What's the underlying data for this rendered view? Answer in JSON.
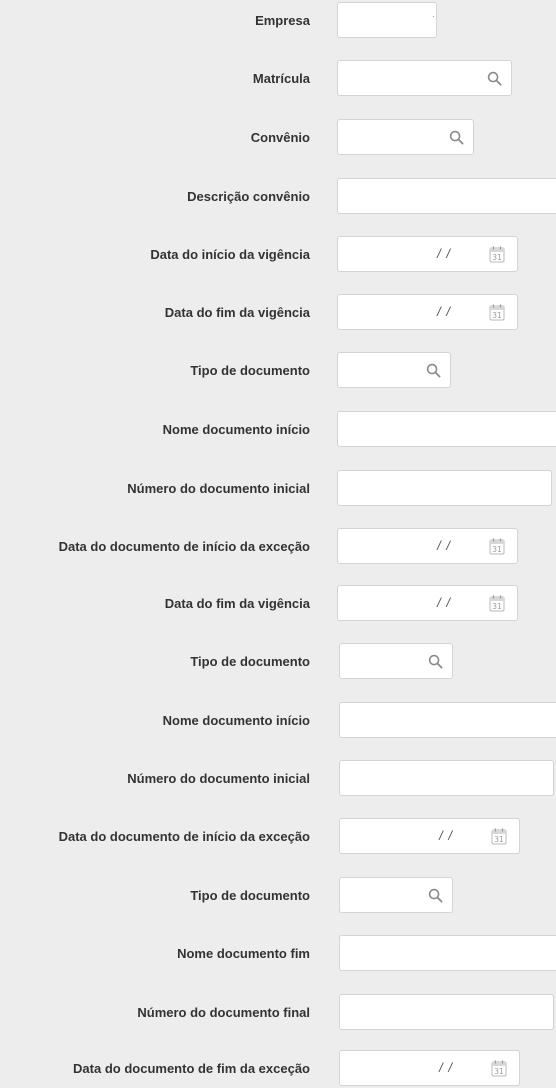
{
  "form": {
    "fields": [
      {
        "label": "Empresa",
        "type": "text"
      },
      {
        "label": "Matrícula",
        "type": "search"
      },
      {
        "label": "Convênio",
        "type": "search"
      },
      {
        "label": "Descrição convênio",
        "type": "text"
      },
      {
        "label": "Data do início da vigência",
        "type": "date",
        "value": "/ /"
      },
      {
        "label": "Data do fim da vigência",
        "type": "date",
        "value": "/ /"
      },
      {
        "label": "Tipo de documento",
        "type": "search"
      },
      {
        "label": "Nome documento início",
        "type": "text"
      },
      {
        "label": "Número do documento inicial",
        "type": "text"
      },
      {
        "label": "Data do documento de início da exceção",
        "type": "date",
        "value": "/ /"
      },
      {
        "label": "Data do fim da vigência",
        "type": "date",
        "value": "/ /"
      },
      {
        "label": "Tipo de documento",
        "type": "search"
      },
      {
        "label": "Nome documento início",
        "type": "text"
      },
      {
        "label": "Número do documento inicial",
        "type": "text"
      },
      {
        "label": "Data do documento de início da exceção",
        "type": "date",
        "value": "/ /"
      },
      {
        "label": "Tipo de documento",
        "type": "search"
      },
      {
        "label": "Nome documento fim",
        "type": "text"
      },
      {
        "label": "Número do documento final",
        "type": "text"
      },
      {
        "label": "Data do documento de fim da exceção",
        "type": "date",
        "value": "/ /"
      }
    ]
  },
  "icons": {
    "search": "search-icon",
    "calendar": "calendar-icon"
  },
  "colors": {
    "background": "#ededed",
    "field": "#ffffff",
    "border": "#d4d4d4",
    "label": "#333333"
  }
}
